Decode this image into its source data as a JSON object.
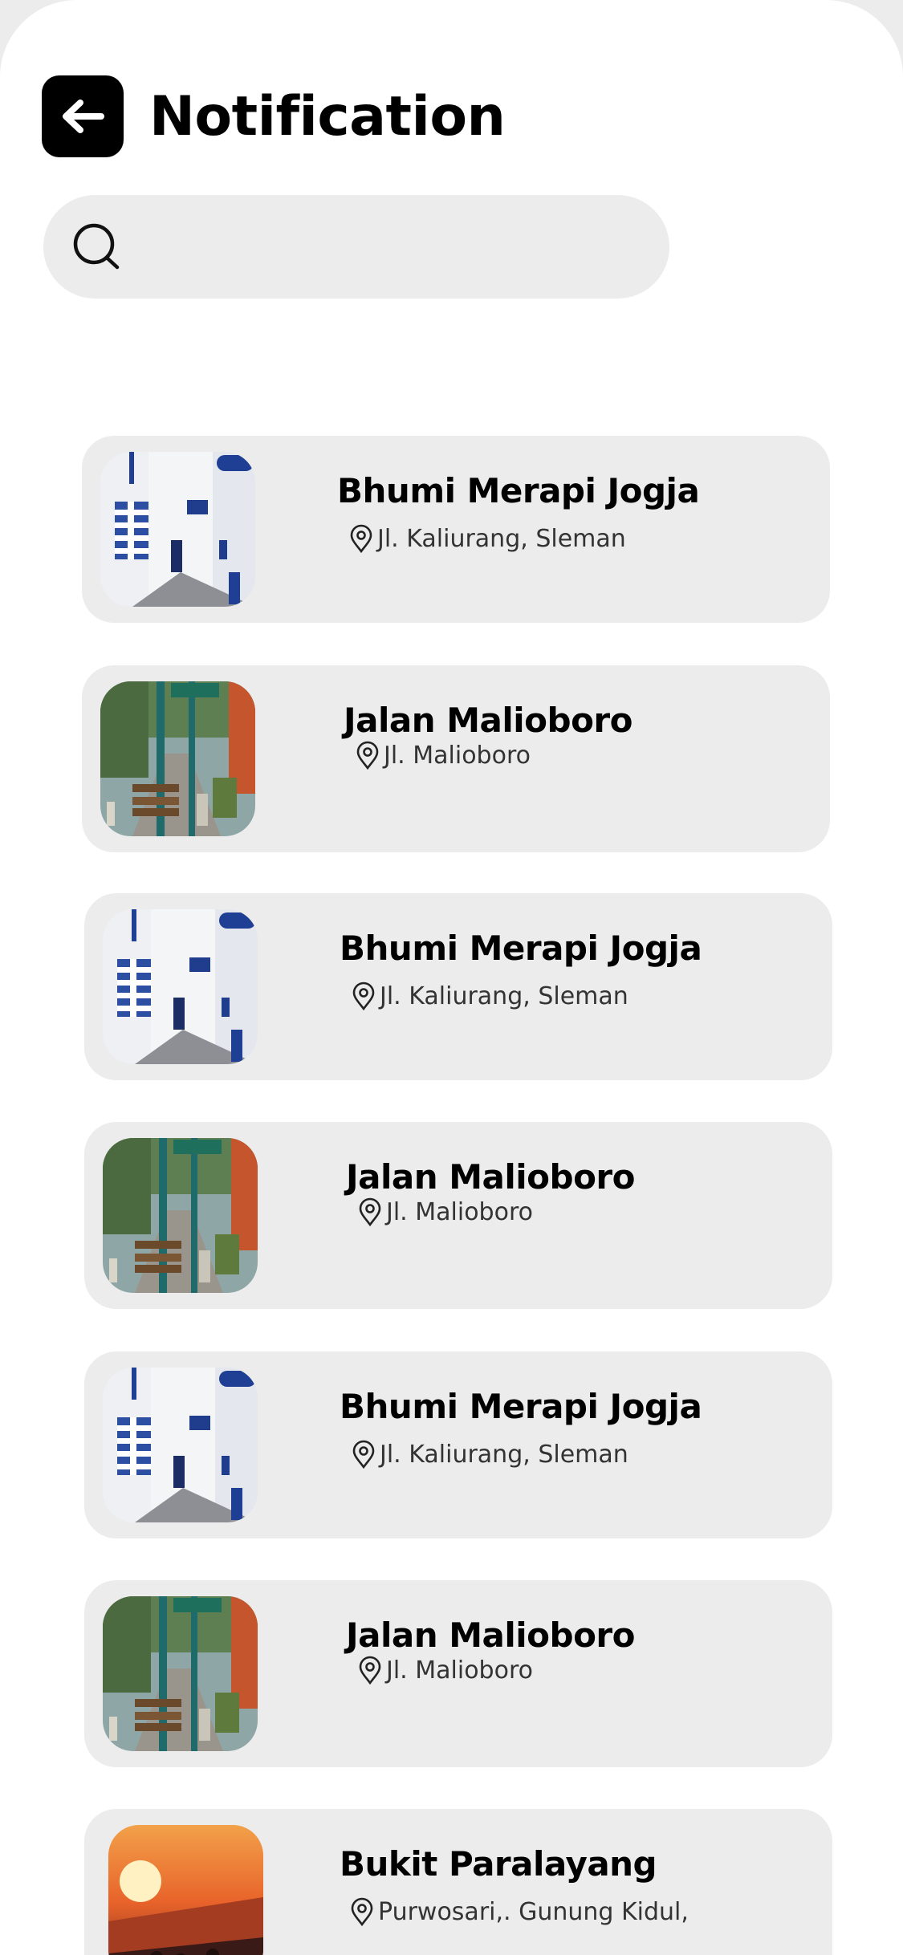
{
  "header": {
    "title": "Notification",
    "back_icon": "arrow-left-icon"
  },
  "search": {
    "icon": "search-icon",
    "value": "",
    "placeholder": ""
  },
  "notifications": [
    {
      "title": "Bhumi Merapi Jogja",
      "location": "Jl. Kaliurang, Sleman",
      "image": "greek-street-photo"
    },
    {
      "title": "Jalan Malioboro",
      "location": "Jl. Malioboro",
      "image": "malioboro-street-photo"
    },
    {
      "title": "Bhumi Merapi Jogja",
      "location": "Jl. Kaliurang, Sleman",
      "image": "greek-street-photo"
    },
    {
      "title": "Jalan Malioboro",
      "location": "Jl. Malioboro",
      "image": "malioboro-street-photo"
    },
    {
      "title": "Bhumi Merapi Jogja",
      "location": "Jl. Kaliurang, Sleman",
      "image": "greek-street-photo"
    },
    {
      "title": "Jalan Malioboro",
      "location": "Jl. Malioboro",
      "image": "malioboro-street-photo"
    },
    {
      "title": "Bukit Paralayang",
      "location": "Purwosari,.  Gunung Kidul,",
      "image": "sunset-cliff-photo"
    }
  ],
  "colors": {
    "background": "#ffffff",
    "card": "#ececec",
    "search_bar": "#ececec",
    "back_button": "#000000",
    "text_primary": "#000000",
    "text_secondary": "#333333"
  }
}
